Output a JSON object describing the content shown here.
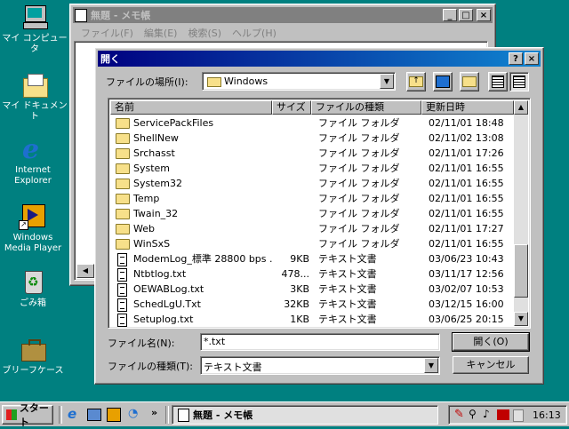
{
  "desktop": {
    "icons": [
      {
        "label": "マイ コンピュータ"
      },
      {
        "label": "マイ ドキュメント"
      },
      {
        "label": "Internet Explorer"
      },
      {
        "label": "Windows Media Player"
      },
      {
        "label": "ごみ箱"
      },
      {
        "label": "ブリーフケース"
      }
    ]
  },
  "notepad": {
    "title": "無題 - メモ帳",
    "menu": [
      "ファイル(F)",
      "編集(E)",
      "検索(S)",
      "ヘルプ(H)"
    ]
  },
  "dialog": {
    "title": "開く",
    "help_btn": "?",
    "close_btn": "×",
    "look_in_label": "ファイルの場所(I):",
    "look_in_value": "Windows",
    "columns": {
      "name": "名前",
      "size": "サイズ",
      "type": "ファイルの種類",
      "modified": "更新日時"
    },
    "files": [
      {
        "name": "ServicePackFiles",
        "size": "",
        "type": "ファイル フォルダ",
        "modified": "02/11/01 18:48",
        "kind": "folder"
      },
      {
        "name": "ShellNew",
        "size": "",
        "type": "ファイル フォルダ",
        "modified": "02/11/02 13:08",
        "kind": "folder"
      },
      {
        "name": "Srchasst",
        "size": "",
        "type": "ファイル フォルダ",
        "modified": "02/11/01 17:26",
        "kind": "folder"
      },
      {
        "name": "System",
        "size": "",
        "type": "ファイル フォルダ",
        "modified": "02/11/01 16:55",
        "kind": "folder"
      },
      {
        "name": "System32",
        "size": "",
        "type": "ファイル フォルダ",
        "modified": "02/11/01 16:55",
        "kind": "folder"
      },
      {
        "name": "Temp",
        "size": "",
        "type": "ファイル フォルダ",
        "modified": "02/11/01 16:55",
        "kind": "folder"
      },
      {
        "name": "Twain_32",
        "size": "",
        "type": "ファイル フォルダ",
        "modified": "02/11/01 16:55",
        "kind": "folder"
      },
      {
        "name": "Web",
        "size": "",
        "type": "ファイル フォルダ",
        "modified": "02/11/01 17:27",
        "kind": "folder"
      },
      {
        "name": "WinSxS",
        "size": "",
        "type": "ファイル フォルダ",
        "modified": "02/11/01 16:55",
        "kind": "folder"
      },
      {
        "name": "ModemLog_標準 28800 bps ...",
        "size": "9KB",
        "type": "テキスト文書",
        "modified": "03/06/23 10:43",
        "kind": "text"
      },
      {
        "name": "Ntbtlog.txt",
        "size": "478...",
        "type": "テキスト文書",
        "modified": "03/11/17 12:56",
        "kind": "text"
      },
      {
        "name": "OEWABLog.txt",
        "size": "3KB",
        "type": "テキスト文書",
        "modified": "03/02/07 10:53",
        "kind": "text"
      },
      {
        "name": "SchedLgU.Txt",
        "size": "32KB",
        "type": "テキスト文書",
        "modified": "03/12/15 16:00",
        "kind": "text"
      },
      {
        "name": "Setuplog.txt",
        "size": "1KB",
        "type": "テキスト文書",
        "modified": "03/06/25 20:15",
        "kind": "text"
      }
    ],
    "filename_label": "ファイル名(N):",
    "filename_value": "*.txt",
    "filetype_label": "ファイルの種類(T):",
    "filetype_value": "テキスト文書",
    "open_button": "開く(O)",
    "cancel_button": "キャンセル"
  },
  "taskbar": {
    "start_label": "スタート",
    "chevron": "»",
    "task_label": "無題 - メモ帳",
    "clock": "16:13"
  },
  "colors": {
    "desktop": "#008080",
    "title_active": "#000080",
    "title_inactive": "#808080",
    "face": "#c0c0c0"
  }
}
